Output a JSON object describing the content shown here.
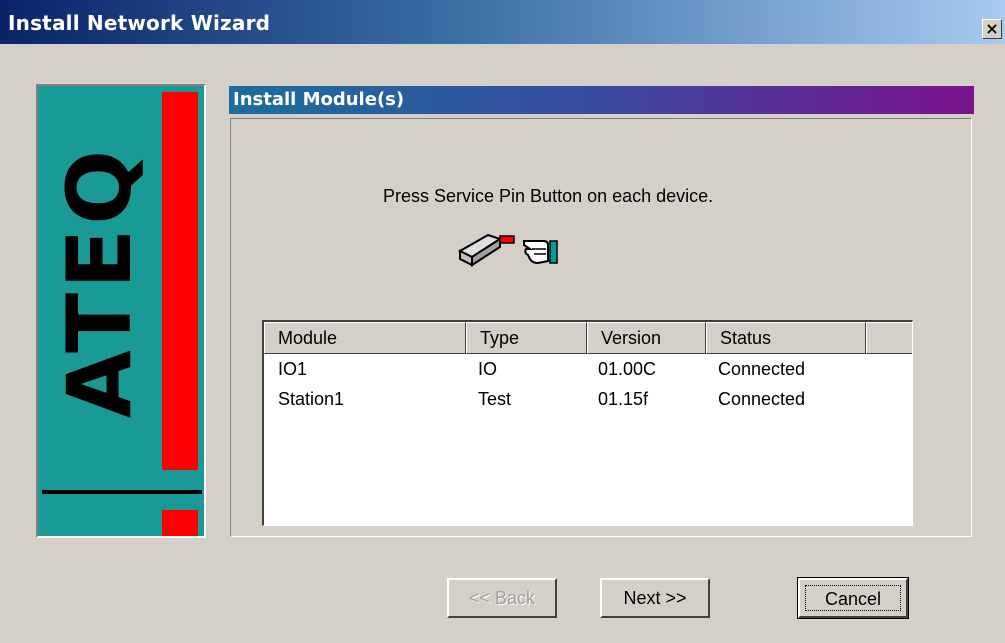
{
  "window": {
    "title": "Install Network Wizard",
    "close_label": "×"
  },
  "logo": {
    "brand_text": "ATEQ"
  },
  "panel": {
    "header": "Install Module(s)",
    "instruction": "Press Service Pin Button on each device."
  },
  "list": {
    "columns": [
      "Module",
      "Type",
      "Version",
      "Status"
    ],
    "rows": [
      {
        "module": "IO1",
        "type": "IO",
        "version": "01.00C",
        "status": "Connected"
      },
      {
        "module": "Station1",
        "type": "Test",
        "version": "01.15f",
        "status": "Connected"
      }
    ]
  },
  "buttons": {
    "back": "<< Back",
    "next": "Next >>",
    "cancel": "Cancel",
    "back_enabled": false
  },
  "colors": {
    "title_start": "#0a246a",
    "logo_teal": "#1a9a96",
    "logo_red": "#ff0000",
    "header_end": "#7a128c"
  },
  "icons": [
    "service-pin-device-icon",
    "pointing-hand-icon",
    "close-icon"
  ]
}
